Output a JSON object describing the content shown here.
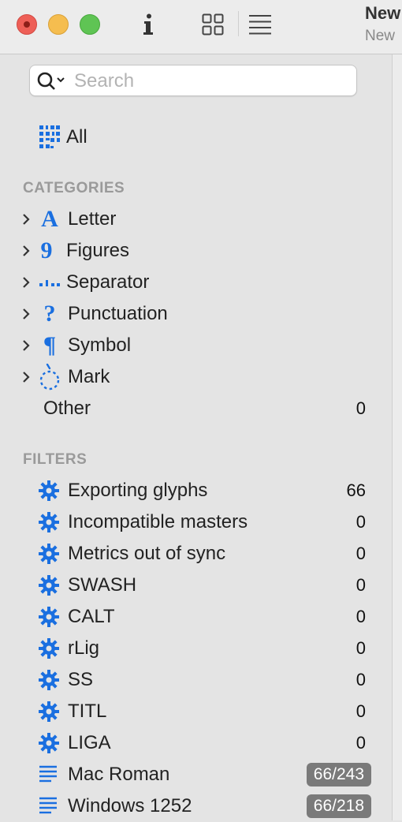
{
  "titlebar": {
    "doc_title": "New",
    "doc_subtitle": "New"
  },
  "search": {
    "placeholder": "Search",
    "value": ""
  },
  "all_item": {
    "label": "All"
  },
  "categories": {
    "heading": "CATEGORIES",
    "items": [
      {
        "label": "Letter",
        "icon": "letter-a-icon",
        "glyph": "A"
      },
      {
        "label": "Figures",
        "icon": "figure-9-icon",
        "glyph": "9"
      },
      {
        "label": "Separator",
        "icon": "separator-icon",
        "glyph": ""
      },
      {
        "label": "Punctuation",
        "icon": "question-mark-icon",
        "glyph": "?"
      },
      {
        "label": "Symbol",
        "icon": "pilcrow-icon",
        "glyph": "¶"
      },
      {
        "label": "Mark",
        "icon": "mark-icon",
        "glyph": ""
      }
    ],
    "other": {
      "label": "Other",
      "count": "0"
    }
  },
  "filters": {
    "heading": "FILTERS",
    "items": [
      {
        "label": "Exporting glyphs",
        "count": "66"
      },
      {
        "label": "Incompatible masters",
        "count": "0"
      },
      {
        "label": "Metrics out of sync",
        "count": "0"
      },
      {
        "label": "SWASH",
        "count": "0"
      },
      {
        "label": "CALT",
        "count": "0"
      },
      {
        "label": "rLig",
        "count": "0"
      },
      {
        "label": "SS",
        "count": "0"
      },
      {
        "label": "TITL",
        "count": "0"
      },
      {
        "label": "LIGA",
        "count": "0"
      }
    ],
    "lists": [
      {
        "label": "Mac Roman",
        "badge": "66/243"
      },
      {
        "label": "Windows 1252",
        "badge": "66/218"
      }
    ]
  },
  "colors": {
    "accent": "#1a6fe0",
    "badge_bg": "#7a7a7a"
  }
}
